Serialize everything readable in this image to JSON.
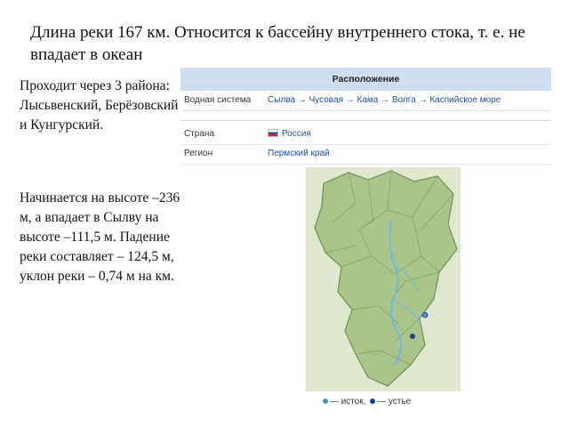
{
  "title": "Длина реки 167 км. Относится к бассейну внутреннего стока, т. е. не впадает в океан",
  "paragraph_1": "Проходит через 3 района: Лысьвенский, Берёзовский и Кунгурский.",
  "paragraph_2": "Начинается на высоте –236 м, а впадает в Сылву на высоте –111,5 м. Падение реки составляет – 124,5  м, уклон реки – 0,74 м на км.",
  "infobox": {
    "header": "Расположение",
    "water_system_label": "Водная система",
    "water_system": [
      "Сылва",
      "Чусовая",
      "Кама",
      "Волга",
      "Каспийское море"
    ],
    "arrow": "→",
    "country_label": "Страна",
    "country": "Россия",
    "region_label": "Регион",
    "region": "Пермский край",
    "legend_source": "— исток,",
    "legend_mouth": "— устье"
  },
  "colors": {
    "header_bg": "#cedff2",
    "link": "#1f50a8",
    "map_land": "#a9c58a",
    "map_water": "#6fb6e8",
    "source_dot": "#4a90d9",
    "mouth_dot": "#1b3f8c"
  }
}
